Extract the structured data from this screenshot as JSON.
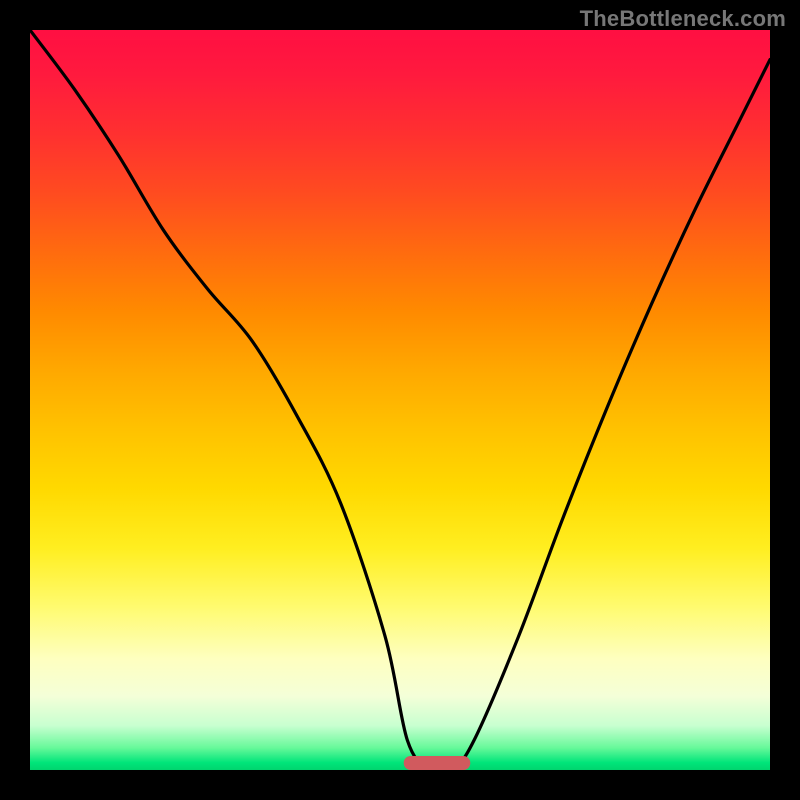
{
  "watermark": "TheBottleneck.com",
  "chart_data": {
    "type": "line",
    "title": "",
    "xlabel": "",
    "ylabel": "",
    "xlim": [
      0,
      100
    ],
    "ylim": [
      0,
      100
    ],
    "grid": false,
    "legend": false,
    "series": [
      {
        "name": "bottleneck-curve",
        "x": [
          0,
          6,
          12,
          18,
          24,
          30,
          36,
          42,
          48,
          51,
          54,
          57,
          60,
          66,
          72,
          78,
          84,
          90,
          96,
          100
        ],
        "values": [
          100,
          92,
          83,
          73,
          65,
          58,
          48,
          36,
          18,
          4,
          0,
          0,
          4,
          18,
          34,
          49,
          63,
          76,
          88,
          96
        ]
      }
    ],
    "annotations": [
      {
        "name": "optimal-marker",
        "shape": "pill",
        "x_center": 55,
        "y": 0.5,
        "width_x": 9,
        "color": "#d15a5e"
      }
    ],
    "background_gradient": {
      "orientation": "vertical",
      "stops": [
        {
          "pos": 0.0,
          "color": "#ff0f42"
        },
        {
          "pos": 0.3,
          "color": "#ff6b0f"
        },
        {
          "pos": 0.6,
          "color": "#ffd900"
        },
        {
          "pos": 0.85,
          "color": "#feffc0"
        },
        {
          "pos": 0.97,
          "color": "#67f99a"
        },
        {
          "pos": 1.0,
          "color": "#00d46e"
        }
      ]
    }
  }
}
